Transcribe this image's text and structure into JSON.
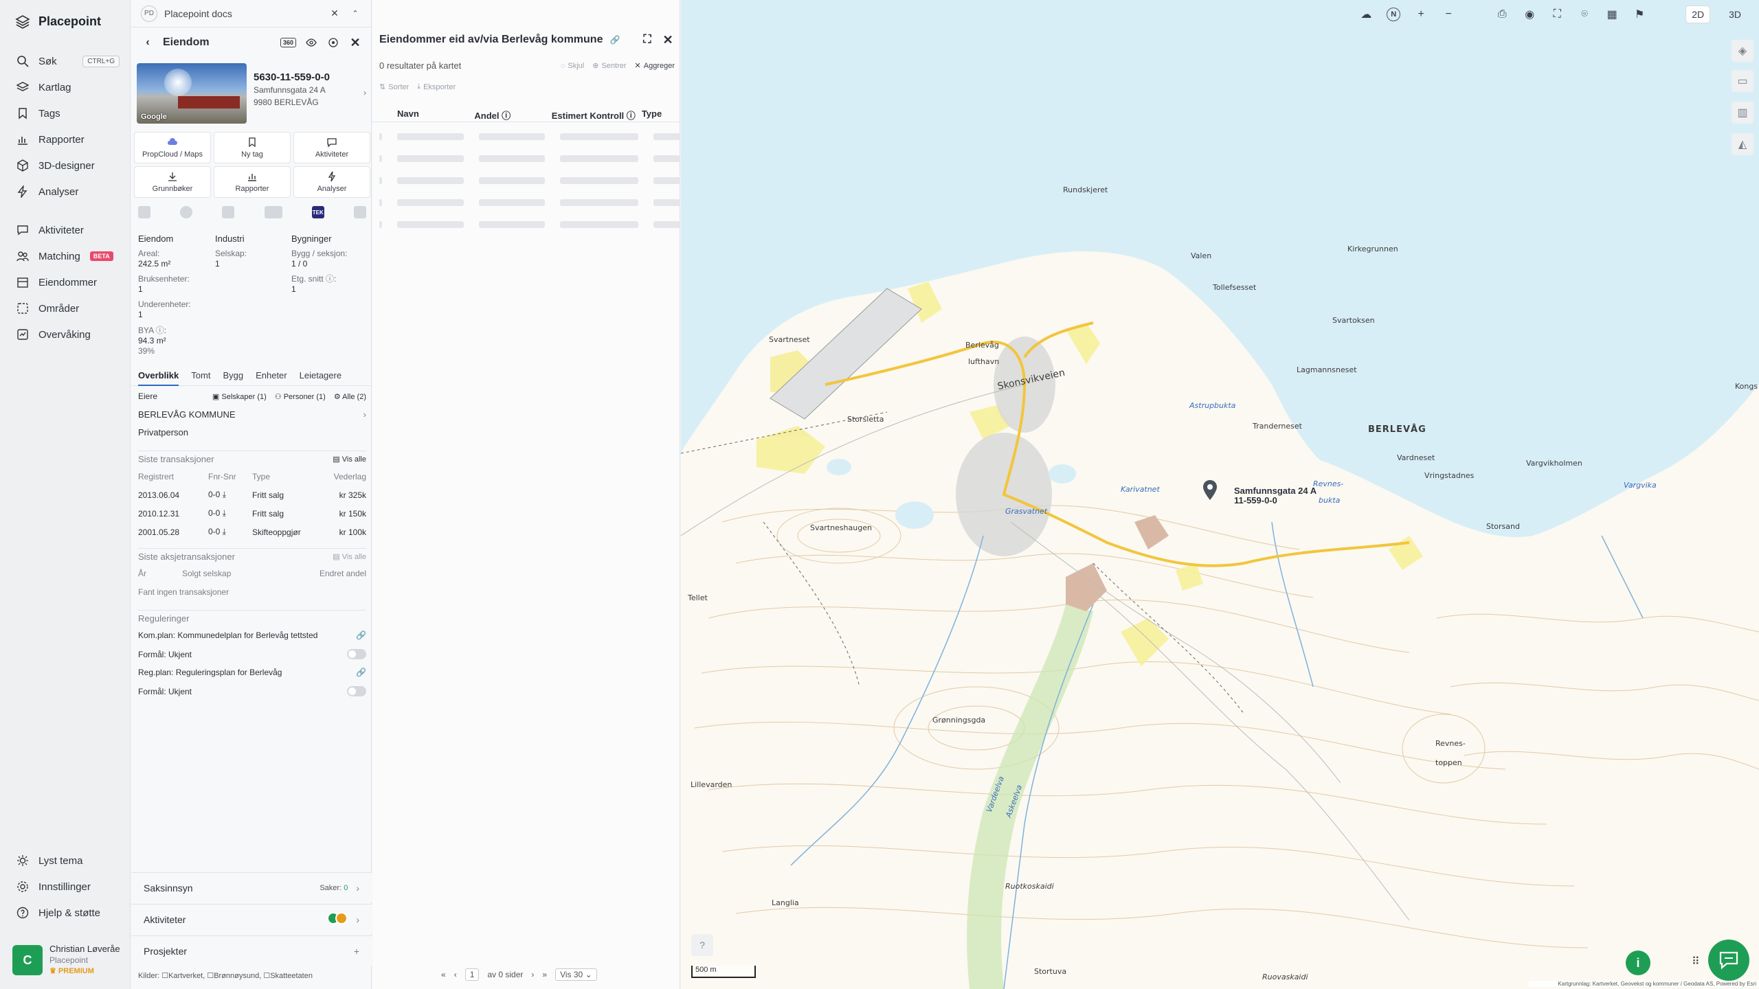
{
  "brand": {
    "name": "Placepoint"
  },
  "nav": {
    "items": [
      {
        "label": "Søk",
        "shortcut": "CTRL+G"
      },
      {
        "label": "Kartlag"
      },
      {
        "label": "Tags"
      },
      {
        "label": "Rapporter"
      },
      {
        "label": "3D-designer"
      },
      {
        "label": "Analyser"
      },
      {
        "label": "Aktiviteter"
      },
      {
        "label": "Matching",
        "badge": "BETA"
      },
      {
        "label": "Eiendommer"
      },
      {
        "label": "Områder"
      },
      {
        "label": "Overvåking"
      }
    ],
    "bottom": [
      {
        "label": "Lyst tema"
      },
      {
        "label": "Innstillinger"
      },
      {
        "label": "Hjelp & støtte"
      }
    ],
    "user": {
      "initial": "C",
      "name": "Christian Løveråe",
      "org": "Placepoint",
      "plan": "PREMIUM"
    }
  },
  "doc_tab": {
    "badge": "PD",
    "title": "Placepoint docs"
  },
  "property": {
    "header": "Eiendom",
    "badge_3d": "360",
    "photo_label": "Google",
    "gnr": "5630-11-559-0-0",
    "address1": "Samfunnsgata 24 A",
    "address2": "9980 BERLEVÅG",
    "actions": [
      {
        "label": "PropCloud / Maps"
      },
      {
        "label": "Ny tag"
      },
      {
        "label": "Aktiviteter"
      },
      {
        "label": "Grunnbøker"
      },
      {
        "label": "Rapporter"
      },
      {
        "label": "Analyser"
      }
    ],
    "tek_label": "TEK",
    "summary": {
      "col1_title": "Eiendom",
      "col2_title": "Industri",
      "col3_title": "Bygninger",
      "areal_label": "Areal:",
      "areal_value": "242.5 m²",
      "selskap_label": "Selskap:",
      "selskap_value": "1",
      "bygg_label": "Bygg / seksjon:",
      "bygg_value": "1 / 0",
      "bruks_label": "Bruksenheter:",
      "bruks_value": "1",
      "etg_label": "Etg. snitt ⓘ:",
      "etg_value": "1",
      "under_label": "Underenheter:",
      "under_value": "1",
      "bya_label": "BYA ⓘ:",
      "bya_value": "94.3 m²",
      "bya_pct": "39%"
    },
    "tabs": [
      "Overblikk",
      "Tomt",
      "Bygg",
      "Enheter",
      "Leietagere"
    ],
    "owners": {
      "title": "Eiere",
      "f_selskaper": "Selskaper (1)",
      "f_personer": "Personer (1)",
      "f_alle": "Alle (2)",
      "name": "BERLEVÅG KOMMUNE",
      "type": "Privatperson"
    },
    "transactions": {
      "title": "Siste transaksjoner",
      "see_all": "Vis alle",
      "headers": [
        "Registrert",
        "Fnr-Snr",
        "Type",
        "Vederlag"
      ],
      "rows": [
        {
          "date": "2013.06.04",
          "fnr": "0-0",
          "type": "Fritt salg",
          "price": "kr 325k"
        },
        {
          "date": "2010.12.31",
          "fnr": "0-0",
          "type": "Fritt salg",
          "price": "kr 150k"
        },
        {
          "date": "2001.05.28",
          "fnr": "0-0",
          "type": "Skifteoppgjør",
          "price": "kr 100k"
        }
      ]
    },
    "share_tx": {
      "title": "Siste aksjetransaksjoner",
      "see_all": "Vis alle",
      "h_year": "År",
      "h_sold": "Solgt selskap",
      "h_changed": "Endret andel",
      "empty": "Fant ingen transaksjoner"
    },
    "regulations": {
      "title": "Reguleringer",
      "kom": "Kom.plan: Kommunedelplan for Berlevåg tettsted",
      "formal1": "Formål: Ukjent",
      "reg": "Reg.plan: Reguleringsplan for Berlevåg",
      "formal2": "Formål: Ukjent"
    },
    "bottom": {
      "saksinnsyn": "Saksinnsyn",
      "saker_label": "Saker:",
      "saker_value": "0",
      "aktiviteter": "Aktiviteter",
      "prosjekter": "Prosjekter",
      "plus": "+"
    },
    "sources": "Kilder: ☐Kartverket, ☐Brønnøysund, ☐Skatteetaten"
  },
  "results": {
    "title": "Eiendommer eid av/via Berlevåg kommune",
    "count": "0 resultater på kartet",
    "tools": {
      "hide": "Skjul",
      "center": "Sentrer",
      "aggregate": "Aggreger",
      "sort": "Sorter",
      "export": "Eksporter"
    },
    "columns": [
      "Navn",
      "Andel ⓘ",
      "Estimert Kontroll ⓘ",
      "Type"
    ],
    "pager": {
      "page": "1",
      "of": "av 0 sider",
      "per": "Vis 30"
    }
  },
  "map": {
    "view_2d": "2D",
    "view_3d": "3D",
    "compass": "N",
    "scale": "500 m",
    "attribution": "Kartgrunnlag: Kartverket, Geovekst og kommuner / Geodata AS, Powered by Esri",
    "pin_label_1": "Samfunnsgata 24 A",
    "pin_label_2": "11-559-0-0",
    "places": [
      {
        "name": "Rundskjeret",
        "water": false
      },
      {
        "name": "Valen",
        "water": false
      },
      {
        "name": "Kirkegrunnen",
        "water": false
      },
      {
        "name": "Tollefsesset",
        "water": false
      },
      {
        "name": "Svartoksen",
        "water": false
      },
      {
        "name": "Svartneset",
        "water": false
      },
      {
        "name": "Berlevåg",
        "water": false
      },
      {
        "name": "lufthavn",
        "water": false
      },
      {
        "name": "Skonsvikveien",
        "water": false
      },
      {
        "name": "Lagmannsneset",
        "water": false
      },
      {
        "name": "Astrupbukta",
        "water": true
      },
      {
        "name": "Storsletta",
        "water": false
      },
      {
        "name": "Tranderneset",
        "water": false
      },
      {
        "name": "BERLEVÅG",
        "water": false
      },
      {
        "name": "Vardneset",
        "water": false
      },
      {
        "name": "Vargvikholmen",
        "water": false
      },
      {
        "name": "Kongs",
        "water": false
      },
      {
        "name": "Karivatnet",
        "water": true
      },
      {
        "name": "Revnes-",
        "water": true
      },
      {
        "name": "bukta",
        "water": true
      },
      {
        "name": "Vringstadnes",
        "water": false
      },
      {
        "name": "Vargvika",
        "water": true
      },
      {
        "name": "Grasvatnet",
        "water": true
      },
      {
        "name": "Svartneshaugen",
        "water": false
      },
      {
        "name": "Storsand",
        "water": false
      },
      {
        "name": "Grønningsgda",
        "water": false
      },
      {
        "name": "Lillevarden",
        "water": false
      },
      {
        "name": "Revnes-",
        "water": false
      },
      {
        "name": "toppen",
        "water": false
      },
      {
        "name": "Ruotkoskaidi",
        "water": false
      },
      {
        "name": "Langlia",
        "water": false
      },
      {
        "name": "Stortuva",
        "water": false
      },
      {
        "name": "Ruovaskaidi",
        "water": false
      },
      {
        "name": "Vardeelva",
        "water": true
      },
      {
        "name": "Askeelva",
        "water": true
      },
      {
        "name": "Tellet",
        "water": false
      }
    ],
    "colors": {
      "sea": "#d8eef7",
      "land": "#fbf9f1",
      "road": "#f2c53d",
      "brand": "#1e9e54"
    }
  }
}
